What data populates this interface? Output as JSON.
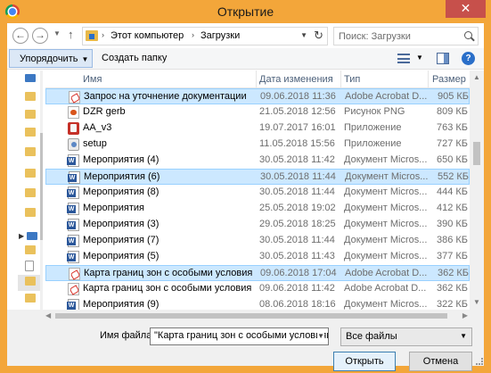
{
  "window": {
    "title": "Открытие",
    "close_label": "✕"
  },
  "nav": {
    "back_glyph": "←",
    "forward_glyph": "→",
    "up_glyph": "↑",
    "breadcrumbs": [
      "Этот компьютер",
      "Загрузки"
    ],
    "search_placeholder": "Поиск: Загрузки"
  },
  "toolbar": {
    "organize_label": "Упорядочить",
    "new_folder_label": "Создать папку",
    "help_label": "?"
  },
  "columns": [
    "Имя",
    "Дата изменения",
    "Тип",
    "Размер"
  ],
  "files": [
    {
      "name": "Запрос на уточнение документации",
      "date": "09.06.2018 11:36",
      "type": "Adobe Acrobat D...",
      "size": "905 КБ",
      "icon": "pdf-icon",
      "selected": true
    },
    {
      "name": "DZR gerb",
      "date": "21.05.2018 12:56",
      "type": "Рисунок PNG",
      "size": "809 КБ",
      "icon": "png-icon",
      "selected": false
    },
    {
      "name": "AA_v3",
      "date": "19.07.2017 16:01",
      "type": "Приложение",
      "size": "763 КБ",
      "icon": "app-icon",
      "selected": false
    },
    {
      "name": "setup",
      "date": "11.05.2018 15:56",
      "type": "Приложение",
      "size": "727 КБ",
      "icon": "setup-icon",
      "selected": false
    },
    {
      "name": "Мероприятия (4)",
      "date": "30.05.2018 11:42",
      "type": "Документ Micros...",
      "size": "650 КБ",
      "icon": "word-doc-icon",
      "selected": false
    },
    {
      "name": "Мероприятия (6)",
      "date": "30.05.2018 11:44",
      "type": "Документ Micros...",
      "size": "552 КБ",
      "icon": "word-doc-icon",
      "selected": true
    },
    {
      "name": "Мероприятия (8)",
      "date": "30.05.2018 11:44",
      "type": "Документ Micros...",
      "size": "444 КБ",
      "icon": "word-doc-icon",
      "selected": false
    },
    {
      "name": "Мероприятия",
      "date": "25.05.2018 19:02",
      "type": "Документ Micros...",
      "size": "412 КБ",
      "icon": "word-doc-icon",
      "selected": false
    },
    {
      "name": "Мероприятия (3)",
      "date": "29.05.2018 18:25",
      "type": "Документ Micros...",
      "size": "390 КБ",
      "icon": "word-doc-icon",
      "selected": false
    },
    {
      "name": "Мероприятия (7)",
      "date": "30.05.2018 11:44",
      "type": "Документ Micros...",
      "size": "386 КБ",
      "icon": "word-doc-icon",
      "selected": false
    },
    {
      "name": "Мероприятия (5)",
      "date": "30.05.2018 11:43",
      "type": "Документ Micros...",
      "size": "377 КБ",
      "icon": "word-doc-icon",
      "selected": false
    },
    {
      "name": "Карта границ зон с особыми условиям...",
      "date": "09.06.2018 17:04",
      "type": "Adobe Acrobat D...",
      "size": "362 КБ",
      "icon": "pdf-icon",
      "selected": true
    },
    {
      "name": "Карта границ зон с особыми условиям...",
      "date": "09.06.2018 11:42",
      "type": "Adobe Acrobat D...",
      "size": "362 КБ",
      "icon": "pdf-icon",
      "selected": false
    },
    {
      "name": "Мероприятия (9)",
      "date": "08.06.2018 18:16",
      "type": "Документ Micros...",
      "size": "322 КБ",
      "icon": "word-doc-icon",
      "selected": false
    }
  ],
  "footer": {
    "filename_label": "Имя файла:",
    "filename_value": "\"Карта границ зон с особыми условиями",
    "filter_value": "Все файлы",
    "open_label": "Открыть",
    "cancel_label": "Отмена"
  }
}
